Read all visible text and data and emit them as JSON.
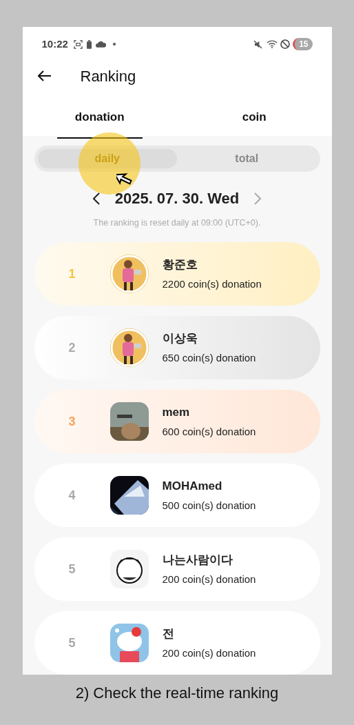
{
  "status_bar": {
    "time": "10:22",
    "notification_count": "15"
  },
  "header": {
    "title": "Ranking"
  },
  "tabs": [
    {
      "label": "donation",
      "selected": true
    },
    {
      "label": "coin",
      "selected": false
    }
  ],
  "period": [
    {
      "label": "daily",
      "selected": true
    },
    {
      "label": "total",
      "selected": false
    }
  ],
  "date": {
    "text": "2025. 07. 30. Wed",
    "next_disabled": true
  },
  "note": "The ranking is reset daily at 09:00 (UTC+0).",
  "rankings": [
    {
      "rank": "1",
      "kind": "gold",
      "name": "황준호",
      "amount": "2200 coin(s) donation"
    },
    {
      "rank": "2",
      "kind": "silver",
      "name": "이상욱",
      "amount": "650 coin(s) donation"
    },
    {
      "rank": "3",
      "kind": "bronze",
      "name": "mem",
      "amount": "600 coin(s) donation"
    },
    {
      "rank": "4",
      "kind": "normal",
      "name": "MOHAmed",
      "amount": "500 coin(s) donation"
    },
    {
      "rank": "5",
      "kind": "normal",
      "name": "나는사람이다",
      "amount": "200 coin(s) donation"
    },
    {
      "rank": "5",
      "kind": "normal",
      "name": "전",
      "amount": "200 coin(s) donation"
    }
  ],
  "caption": "2) Check the real-time ranking"
}
